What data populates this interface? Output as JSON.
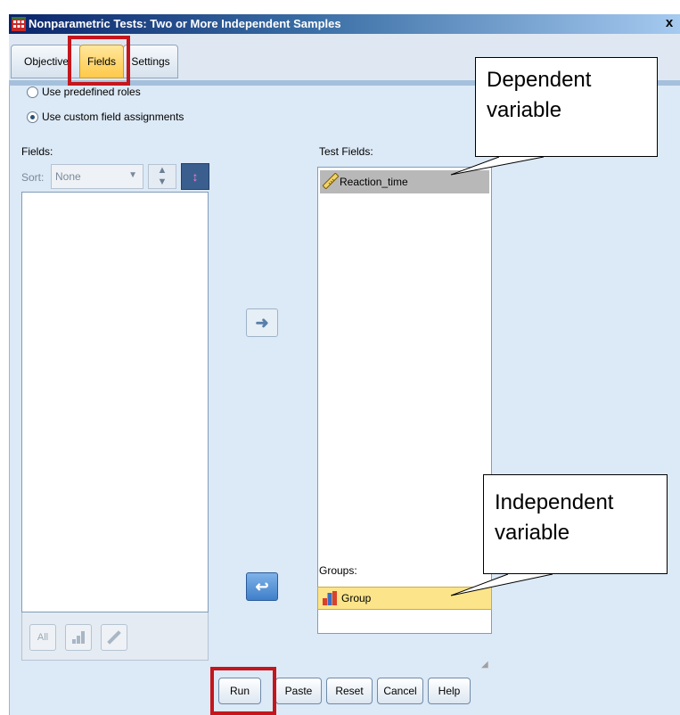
{
  "window": {
    "title": "Nonparametric Tests: Two or More Independent Samples",
    "close_glyph": "x"
  },
  "tabs": [
    {
      "label": "Objective"
    },
    {
      "label": "Fields"
    },
    {
      "label": "Settings"
    }
  ],
  "roles": {
    "predefined_label": "Use predefined roles",
    "custom_label": "Use custom field assignments",
    "selected": "custom"
  },
  "fields_panel": {
    "label": "Fields:",
    "sort_label": "Sort:",
    "sort_value": "None",
    "all_button": "All"
  },
  "test_fields": {
    "label": "Test Fields:",
    "items": [
      "Reaction_time"
    ]
  },
  "groups": {
    "label": "Groups:",
    "value": "Group"
  },
  "buttons": {
    "run": "Run",
    "paste": "Paste",
    "reset": "Reset",
    "cancel": "Cancel",
    "help": "Help"
  },
  "callouts": {
    "dependent": [
      "Dependent",
      "variable"
    ],
    "independent": [
      "Independent",
      "variable"
    ]
  },
  "colors": {
    "highlight_red": "#c4161c",
    "active_tab": "#ffc94a",
    "groups_fill": "#fbe48a",
    "title_bar": "#0a246a"
  }
}
